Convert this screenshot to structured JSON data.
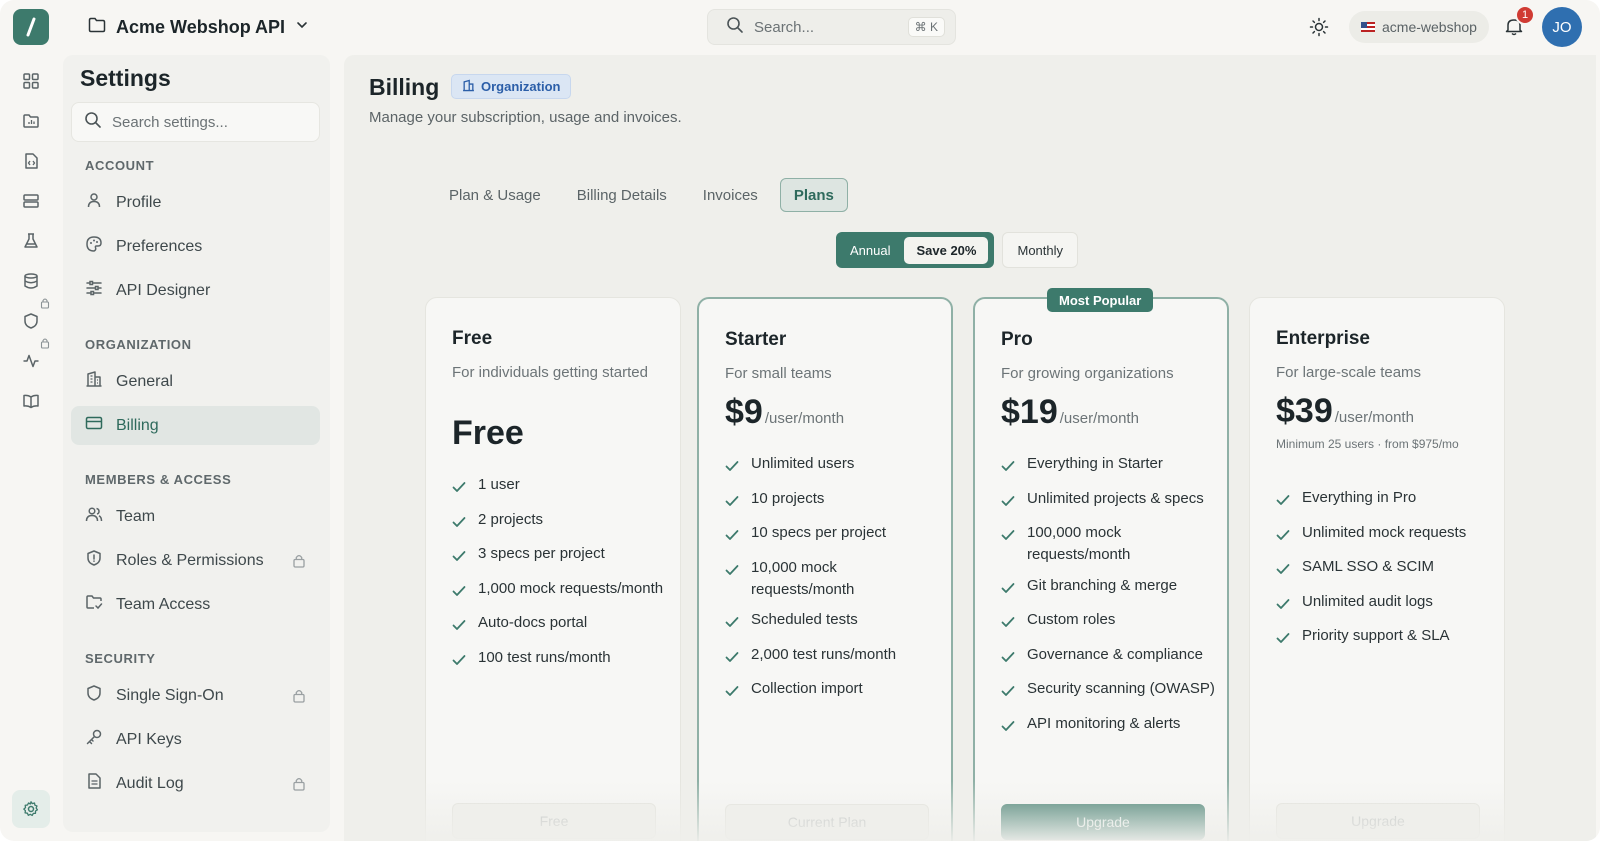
{
  "header": {
    "project_name": "Acme Webshop API",
    "search_placeholder": "Search...",
    "search_shortcut": "⌘ K",
    "workspace": "acme-webshop",
    "notification_count": "1",
    "avatar_initials": "JO"
  },
  "sidebar": {
    "title": "Settings",
    "search_placeholder": "Search settings...",
    "sections": {
      "account": "ACCOUNT",
      "organization": "ORGANIZATION",
      "members": "MEMBERS & ACCESS",
      "security": "SECURITY"
    },
    "items": {
      "profile": "Profile",
      "preferences": "Preferences",
      "api_designer": "API Designer",
      "general": "General",
      "billing": "Billing",
      "team": "Team",
      "roles": "Roles & Permissions",
      "team_access": "Team Access",
      "sso": "Single Sign-On",
      "api_keys": "API Keys",
      "audit_log": "Audit Log"
    }
  },
  "page": {
    "title": "Billing",
    "scope_chip": "Organization",
    "subtitle": "Manage your subscription, usage and invoices.",
    "tabs": [
      "Plan & Usage",
      "Billing Details",
      "Invoices",
      "Plans"
    ],
    "active_tab": "Plans"
  },
  "billing_toggle": {
    "annual": "Annual",
    "save": "Save 20%",
    "monthly": "Monthly",
    "selected": "Annual"
  },
  "plans": [
    {
      "name": "Free",
      "description": "For individuals getting started",
      "price": "Free",
      "features": [
        "1 user",
        "2 projects",
        "3 specs per project",
        "1,000 mock requests/month",
        "Auto-docs portal",
        "100 test runs/month"
      ],
      "button": "Free"
    },
    {
      "name": "Starter",
      "description": "For small teams",
      "price": "$9",
      "unit": "/user/month",
      "features": [
        "Unlimited users",
        "10 projects",
        "10 specs per project",
        "10,000 mock requests/month",
        "Scheduled tests",
        "2,000 test runs/month",
        "Collection import"
      ],
      "button": "Current Plan"
    },
    {
      "name": "Pro",
      "badge": "Most Popular",
      "description": "For growing organizations",
      "price": "$19",
      "unit": "/user/month",
      "features": [
        "Everything in Starter",
        "Unlimited projects & specs",
        "100,000 mock requests/month",
        "Git branching & merge",
        "Custom roles",
        "Governance & compliance",
        "Security scanning (OWASP)",
        "API monitoring & alerts"
      ],
      "button": "Upgrade"
    },
    {
      "name": "Enterprise",
      "description": "For large-scale teams",
      "price": "$39",
      "unit": "/user/month",
      "note": "Minimum 25 users · from $975/mo",
      "features": [
        "Everything in Pro",
        "Unlimited mock requests",
        "SAML SSO & SCIM",
        "Unlimited audit logs",
        "Priority support & SLA"
      ],
      "button": "Upgrade"
    }
  ],
  "colors": {
    "accent": "#3d7a6c",
    "accent_light": "#dde5e1",
    "org_chip": "#2b5ea8",
    "badge_red": "#d03b33",
    "avatar": "#2f6fb0"
  }
}
